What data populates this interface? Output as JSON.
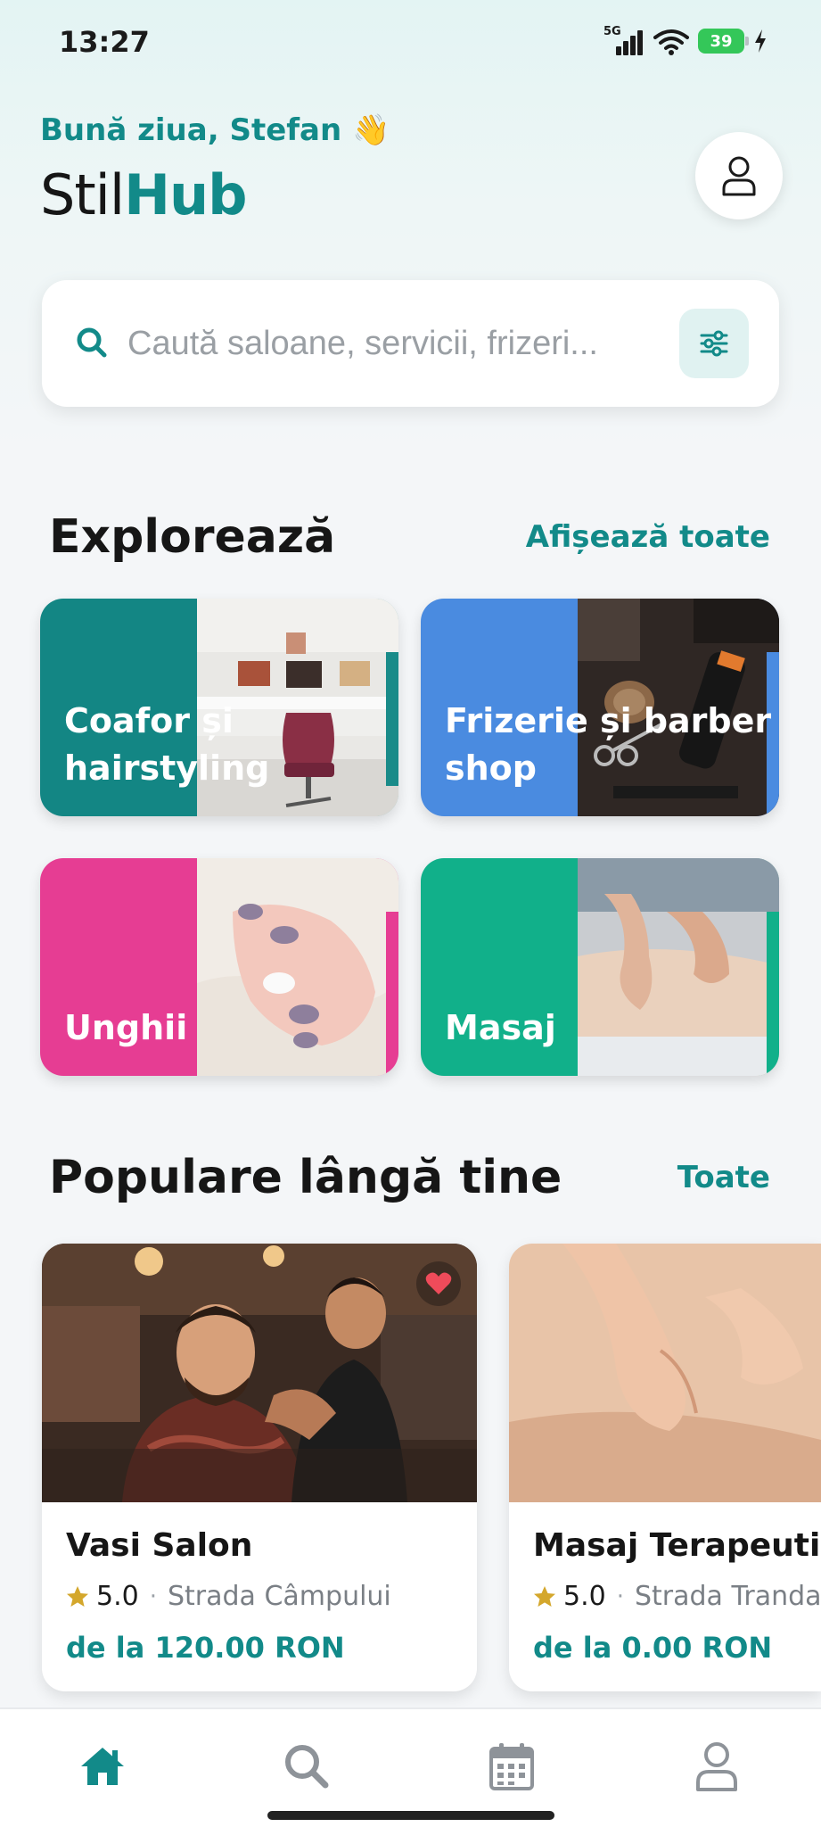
{
  "status_bar": {
    "time": "13:27",
    "network": "5G",
    "battery": "39"
  },
  "header": {
    "greeting": "Bună ziua, Stefan 👋",
    "brand_light": "Stil",
    "brand_bold": "Hub"
  },
  "search": {
    "placeholder": "Caută saloane, servicii, frizeri..."
  },
  "explore": {
    "title": "Explorează",
    "link": "Afișează toate",
    "categories": [
      {
        "label": "Coafor și hairstyling",
        "color": "#138684"
      },
      {
        "label": "Frizerie și barber shop",
        "color": "#4a8be0"
      },
      {
        "label": "Unghii",
        "color": "#e63d93"
      },
      {
        "label": "Masaj",
        "color": "#11b08a"
      }
    ]
  },
  "popular": {
    "title": "Populare lângă tine",
    "link": "Toate",
    "items": [
      {
        "name": "Vasi Salon",
        "rating": "5.0",
        "street": "Strada Câmpului",
        "price": "de la 120.00 RON",
        "favorite": true
      },
      {
        "name": "Masaj Terapeutic",
        "rating": "5.0",
        "street": "Strada Trandafi",
        "price": "de la 0.00 RON",
        "favorite": false
      }
    ]
  },
  "nav": {
    "active": "home"
  },
  "colors": {
    "accent": "#128a89",
    "star": "#d4a72c",
    "heart": "#ef4b5a"
  }
}
